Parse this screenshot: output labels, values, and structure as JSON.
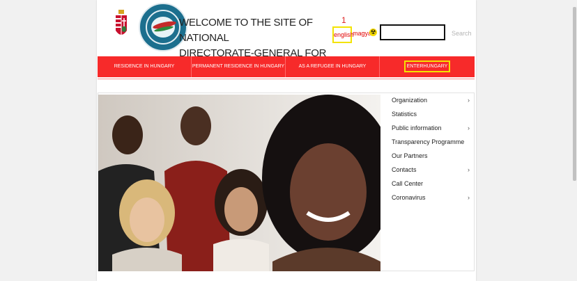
{
  "header": {
    "title_line1": "WELCOME TO THE SITE OF NATIONAL",
    "title_line2": "DIRECTORATE-GENERAL FOR ALIENS POLICING"
  },
  "annotation": {
    "marker": "1"
  },
  "languages": {
    "english": "english",
    "hungarian": "magyar"
  },
  "accessibility": {
    "icon": "accessibility-icon"
  },
  "search": {
    "value": "",
    "label": "Search"
  },
  "nav": {
    "items": [
      {
        "label": "RESIDENCE IN HUNGARY"
      },
      {
        "label": "PERMANENT RESIDENCE IN HUNGARY"
      },
      {
        "label": "AS A REFUGEE IN HUNGARY"
      },
      {
        "label": "ENTERHUNGARY"
      }
    ]
  },
  "sidebar": {
    "items": [
      {
        "label": "Organization",
        "has_submenu": true
      },
      {
        "label": "Statistics",
        "has_submenu": false
      },
      {
        "label": "Public information",
        "has_submenu": true
      },
      {
        "label": "Transparency Programme",
        "has_submenu": false
      },
      {
        "label": "Our Partners",
        "has_submenu": false
      },
      {
        "label": "Contacts",
        "has_submenu": true
      },
      {
        "label": "Call Center",
        "has_submenu": false
      },
      {
        "label": "Coronavirus",
        "has_submenu": true
      }
    ],
    "arrow_glyph": "›"
  },
  "colors": {
    "nav": "#f72a2a",
    "highlight": "#f3e300",
    "lang": "#e10000"
  }
}
